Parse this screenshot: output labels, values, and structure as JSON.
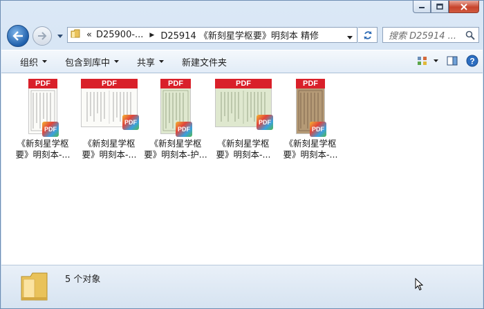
{
  "window": {
    "caption_buttons": [
      "minimize",
      "maximize",
      "close"
    ]
  },
  "nav": {
    "breadcrumb": [
      "«",
      "D25900-...",
      "D25914 《新刻星学枢要》明刻本 精修"
    ],
    "search_placeholder": "搜索 D25914 ..."
  },
  "toolbar": {
    "items": [
      "组织",
      "包含到库中",
      "共享",
      "新建文件夹"
    ]
  },
  "files": [
    {
      "line1": "《新刻星学枢",
      "line2": "要》明刻本-...",
      "thumb": "white-portrait",
      "type_label": "PDF",
      "badge": "PDF"
    },
    {
      "line1": "《新刻星学枢",
      "line2": "要》明刻本-...",
      "thumb": "white-landscape",
      "type_label": "PDF",
      "badge": "PDF"
    },
    {
      "line1": "《新刻星学枢",
      "line2": "要》明刻本-护...",
      "thumb": "green-portrait",
      "type_label": "PDF",
      "badge": "PDF"
    },
    {
      "line1": "《新刻星学枢",
      "line2": "要》明刻本-...",
      "thumb": "green-landscape",
      "type_label": "PDF",
      "badge": "PDF"
    },
    {
      "line1": "《新刻星学枢",
      "line2": "要》明刻本-...",
      "thumb": "brown-portrait",
      "type_label": "PDF",
      "badge": "PDF"
    }
  ],
  "status": {
    "count_text": "5 个对象"
  }
}
